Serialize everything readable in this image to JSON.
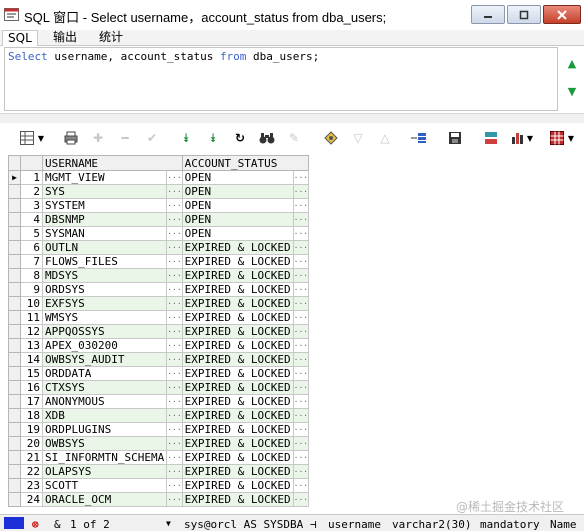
{
  "window": {
    "title": "SQL 窗口 - Select username，account_status from dba_users;"
  },
  "tabs": [
    {
      "label": "SQL"
    },
    {
      "label": "输出"
    },
    {
      "label": "统计"
    }
  ],
  "editor": {
    "kw_select": "Select",
    "text_mid": " username, account_status ",
    "kw_from": "from",
    "text_end": " dba_users;"
  },
  "grid": {
    "columns": [
      "USERNAME",
      "ACCOUNT_STATUS"
    ],
    "rows": [
      {
        "num": "1",
        "username": "MGMT_VIEW",
        "status": "OPEN"
      },
      {
        "num": "2",
        "username": "SYS",
        "status": "OPEN"
      },
      {
        "num": "3",
        "username": "SYSTEM",
        "status": "OPEN"
      },
      {
        "num": "4",
        "username": "DBSNMP",
        "status": "OPEN"
      },
      {
        "num": "5",
        "username": "SYSMAN",
        "status": "OPEN"
      },
      {
        "num": "6",
        "username": "OUTLN",
        "status": "EXPIRED & LOCKED"
      },
      {
        "num": "7",
        "username": "FLOWS_FILES",
        "status": "EXPIRED & LOCKED"
      },
      {
        "num": "8",
        "username": "MDSYS",
        "status": "EXPIRED & LOCKED"
      },
      {
        "num": "9",
        "username": "ORDSYS",
        "status": "EXPIRED & LOCKED"
      },
      {
        "num": "10",
        "username": "EXFSYS",
        "status": "EXPIRED & LOCKED"
      },
      {
        "num": "11",
        "username": "WMSYS",
        "status": "EXPIRED & LOCKED"
      },
      {
        "num": "12",
        "username": "APPQOSSYS",
        "status": "EXPIRED & LOCKED"
      },
      {
        "num": "13",
        "username": "APEX_030200",
        "status": "EXPIRED & LOCKED"
      },
      {
        "num": "14",
        "username": "OWBSYS_AUDIT",
        "status": "EXPIRED & LOCKED"
      },
      {
        "num": "15",
        "username": "ORDDATA",
        "status": "EXPIRED & LOCKED"
      },
      {
        "num": "16",
        "username": "CTXSYS",
        "status": "EXPIRED & LOCKED"
      },
      {
        "num": "17",
        "username": "ANONYMOUS",
        "status": "EXPIRED & LOCKED"
      },
      {
        "num": "18",
        "username": "XDB",
        "status": "EXPIRED & LOCKED"
      },
      {
        "num": "19",
        "username": "ORDPLUGINS",
        "status": "EXPIRED & LOCKED"
      },
      {
        "num": "20",
        "username": "OWBSYS",
        "status": "EXPIRED & LOCKED"
      },
      {
        "num": "21",
        "username": "SI_INFORMTN_SCHEMA",
        "status": "EXPIRED & LOCKED"
      },
      {
        "num": "22",
        "username": "OLAPSYS",
        "status": "EXPIRED & LOCKED"
      },
      {
        "num": "23",
        "username": "SCOTT",
        "status": "EXPIRED & LOCKED"
      },
      {
        "num": "24",
        "username": "ORACLE_OCM",
        "status": "EXPIRED & LOCKED"
      }
    ]
  },
  "statusbar": {
    "record": "1 of 2",
    "connection": "sys@orcl AS SYSDBA",
    "field_name": "username",
    "field_type": "varchar2(30)",
    "field_req": "mandatory",
    "name_label": "Name"
  },
  "watermark": "@稀土掘金技术社区",
  "colors": {
    "keyword": "#3b64c8",
    "alt_row": "#eaf6e8",
    "close_button": "#c4402b"
  },
  "icons": [
    "sql-window-icon",
    "minimize-icon",
    "maximize-icon",
    "close-icon",
    "scroll-up-icon",
    "scroll-down-icon",
    "grid-toggle-icon",
    "print-icon",
    "add-record-icon",
    "delete-record-icon",
    "post-icon",
    "fetch-next-icon",
    "fetch-last-icon",
    "refresh-icon",
    "find-icon",
    "clear-icon",
    "query-by-example-icon",
    "filter-icon",
    "sort-icon",
    "export-icon",
    "save-icon",
    "compare-icon",
    "chart-icon",
    "table-icon"
  ]
}
